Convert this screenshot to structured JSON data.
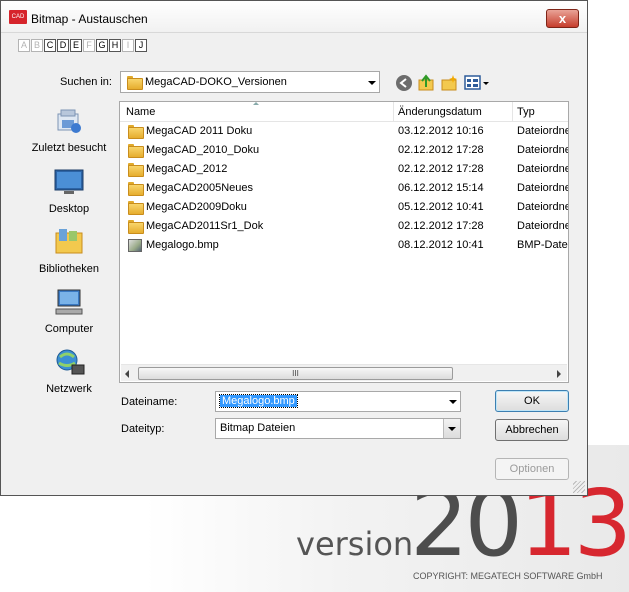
{
  "splash": {
    "version_word": "version",
    "year_dark": "20",
    "year_red": "1",
    "year_dark2": "3",
    "copyright": "COPYRIGHT: MEGATECH SOFTWARE GmbH"
  },
  "window": {
    "title": "Bitmap - Austauschen",
    "app_icon_text": "CAD",
    "close_glyph": "x"
  },
  "letters": [
    {
      "ch": "A",
      "on": false
    },
    {
      "ch": "B",
      "on": false
    },
    {
      "ch": "C",
      "on": true
    },
    {
      "ch": "D",
      "on": true
    },
    {
      "ch": "E",
      "on": true
    },
    {
      "ch": "F",
      "on": false
    },
    {
      "ch": "G",
      "on": true
    },
    {
      "ch": "H",
      "on": true
    },
    {
      "ch": "I",
      "on": false
    },
    {
      "ch": "J",
      "on": true
    }
  ],
  "lookin": {
    "label": "Suchen in:",
    "value": "MegaCAD-DOKO_Versionen"
  },
  "toolbar": {
    "back_icon": "back-arrow-icon",
    "up_icon": "folder-up-icon",
    "new_folder_icon": "new-folder-icon",
    "views_icon": "view-menu-icon"
  },
  "places": [
    {
      "label": "Zuletzt besucht",
      "icon": "recent-places-icon"
    },
    {
      "label": "Desktop",
      "icon": "desktop-icon"
    },
    {
      "label": "Bibliotheken",
      "icon": "libraries-icon"
    },
    {
      "label": "Computer",
      "icon": "computer-icon"
    },
    {
      "label": "Netzwerk",
      "icon": "network-icon"
    }
  ],
  "filelist": {
    "columns": {
      "name": "Name",
      "date": "Änderungsdatum",
      "type": "Typ"
    },
    "rows": [
      {
        "name": "MegaCAD 2011 Doku",
        "date": "03.12.2012 10:16",
        "type": "Dateiordner",
        "kind": "folder"
      },
      {
        "name": "MegaCAD_2010_Doku",
        "date": "02.12.2012 17:28",
        "type": "Dateiordner",
        "kind": "folder"
      },
      {
        "name": "MegaCAD_2012",
        "date": "02.12.2012 17:28",
        "type": "Dateiordner",
        "kind": "folder"
      },
      {
        "name": "MegaCAD2005Neues",
        "date": "06.12.2012 15:14",
        "type": "Dateiordner",
        "kind": "folder"
      },
      {
        "name": "MegaCAD2009Doku",
        "date": "05.12.2012 10:41",
        "type": "Dateiordner",
        "kind": "folder"
      },
      {
        "name": "MegaCAD2011Sr1_Dok",
        "date": "02.12.2012 17:28",
        "type": "Dateiordner",
        "kind": "folder"
      },
      {
        "name": "Megalogo.bmp",
        "date": "08.12.2012 10:41",
        "type": "BMP-Datei",
        "kind": "bmp"
      }
    ],
    "scroll_grip": "III"
  },
  "filename": {
    "label": "Dateiname:",
    "value": "Megalogo.bmp"
  },
  "filetype": {
    "label": "Dateityp:",
    "value": "Bitmap Dateien"
  },
  "buttons": {
    "ok": "OK",
    "cancel": "Abbrechen",
    "options": "Optionen"
  }
}
